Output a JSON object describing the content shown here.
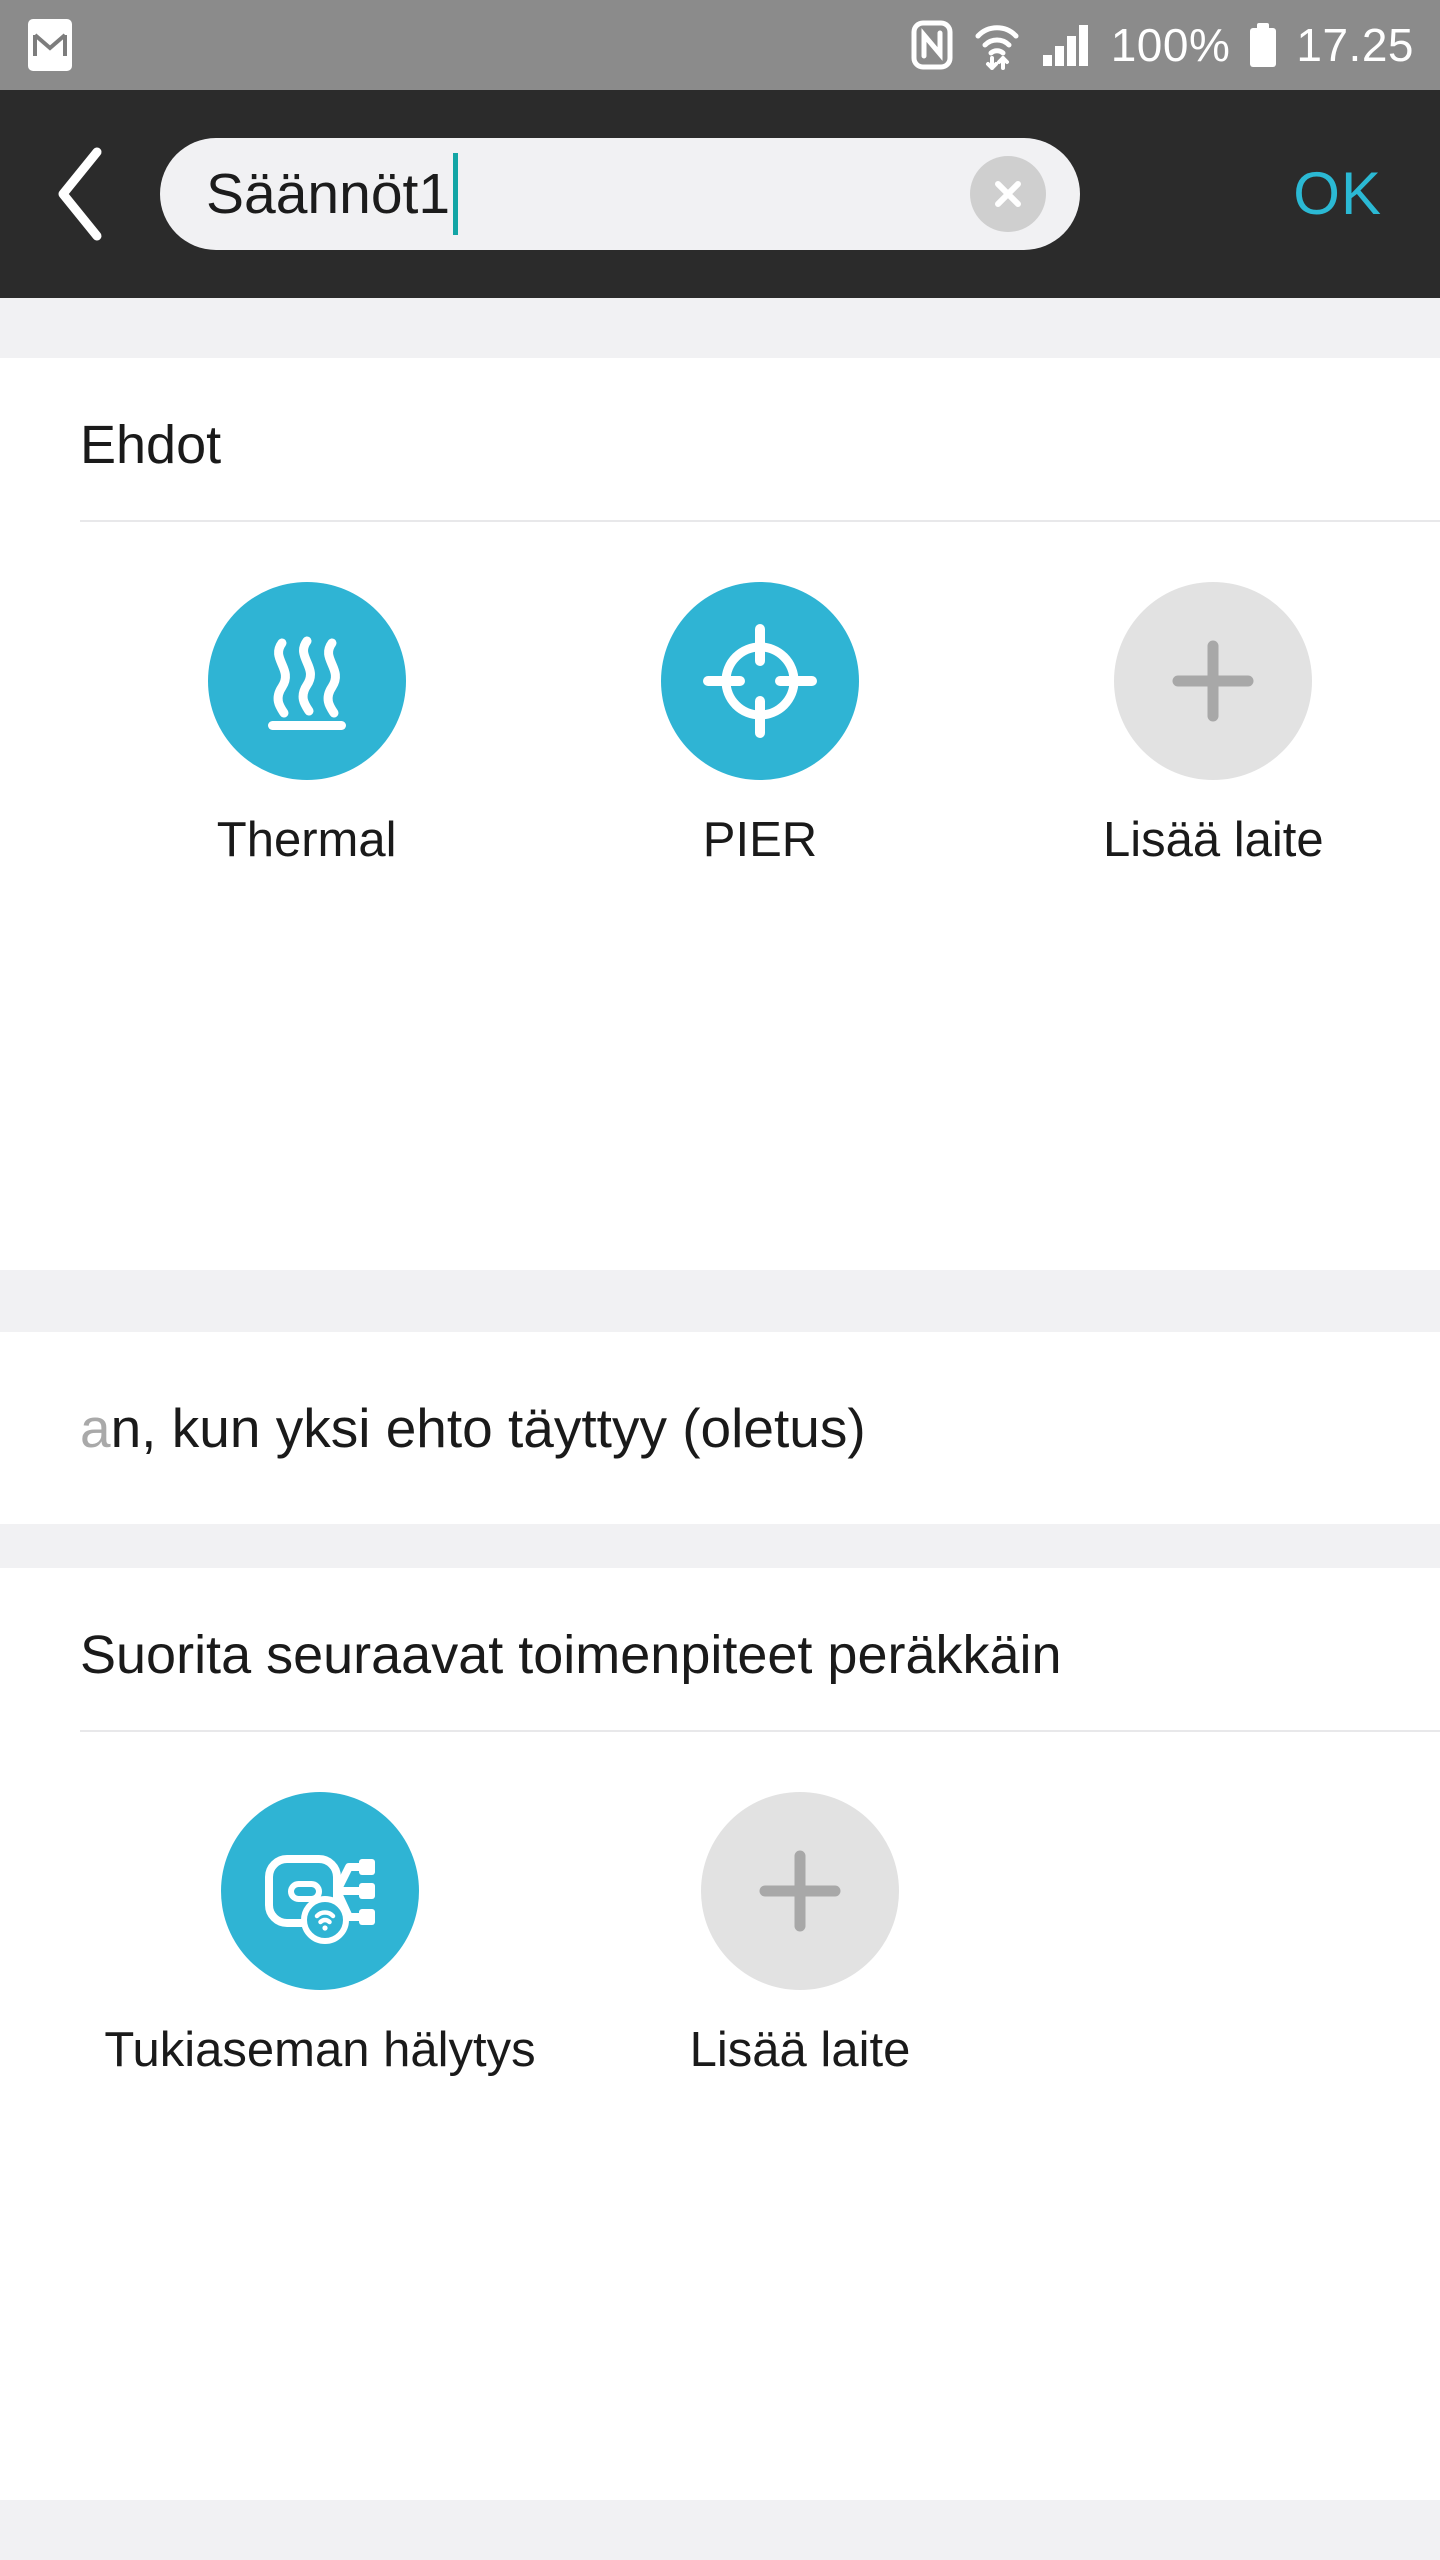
{
  "status_bar": {
    "notification_icon": "gmail-icon",
    "nfc_icon": "nfc-icon",
    "wifi_icon": "wifi-transfer-icon",
    "signal_icon": "cellular-signal-icon",
    "battery_percent": "100%",
    "battery_icon": "battery-full-icon",
    "time": "17.25"
  },
  "app_bar": {
    "back_icon": "back-chevron-icon",
    "search_value": "Säännöt1",
    "search_placeholder": "Säännöt1",
    "clear_icon": "clear-circle-icon",
    "confirm_label": "OK"
  },
  "conditions": {
    "title": "Ehdot",
    "tiles": [
      {
        "label": "Thermal",
        "icon": "heat-waves-icon",
        "style": "accent"
      },
      {
        "label": "PIER",
        "icon": "crosshair-target-icon",
        "style": "accent"
      },
      {
        "label": "Lisää laite",
        "icon": "plus-icon",
        "style": "muted"
      }
    ]
  },
  "rule_mode": {
    "text_visible": "n, kun yksi ehto täyttyy (oletus)",
    "text_faded_lead": "a"
  },
  "actions": {
    "title": "Suorita seuraavat toimenpiteet peräkkäin",
    "tiles": [
      {
        "label": "Tukiaseman hälytys",
        "icon": "gateway-alarm-icon",
        "style": "accent"
      },
      {
        "label": "Lisää laite",
        "icon": "plus-icon",
        "style": "muted"
      }
    ]
  },
  "colors": {
    "accent": "#2fb4d4",
    "confirm": "#2bb9d4",
    "caret": "#13a5a5",
    "app_bar_bg": "#2b2b2b",
    "status_bar_bg": "#8b8b8b",
    "band_bg": "#f1f1f3",
    "muted_circle": "#e2e2e2"
  }
}
